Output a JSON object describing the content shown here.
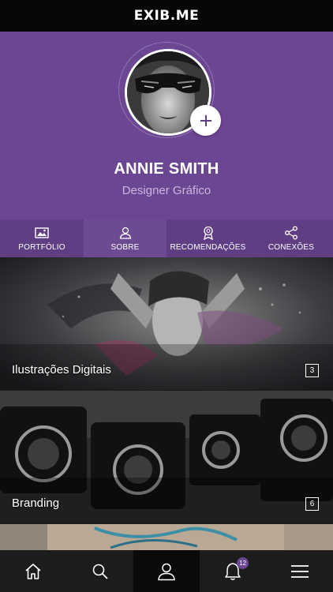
{
  "app": {
    "title": "EXIB.ME"
  },
  "profile": {
    "name": "ANNIE SMITH",
    "role": "Designer Gráfico",
    "add_icon": "plus-icon"
  },
  "tabs": [
    {
      "label": "PORTFÓLIO",
      "icon": "image-icon",
      "active": false
    },
    {
      "label": "SOBRE",
      "icon": "user-icon",
      "active": true
    },
    {
      "label": "RECOMENDAÇÕES",
      "icon": "award-icon",
      "active": false
    },
    {
      "label": "CONEXÕES",
      "icon": "share-icon",
      "active": false
    }
  ],
  "portfolio": [
    {
      "title": "Ilustrações Digitais",
      "count": "3"
    },
    {
      "title": "Branding",
      "count": "6"
    }
  ],
  "bottom_nav": [
    {
      "icon": "home-icon"
    },
    {
      "icon": "search-icon"
    },
    {
      "icon": "profile-icon",
      "active": true
    },
    {
      "icon": "bell-icon",
      "badge": "12"
    },
    {
      "icon": "menu-icon"
    }
  ],
  "colors": {
    "brand_purple": "#6b4692",
    "tabs_bg": "#5f3e84",
    "dark": "#1c1c1c"
  }
}
